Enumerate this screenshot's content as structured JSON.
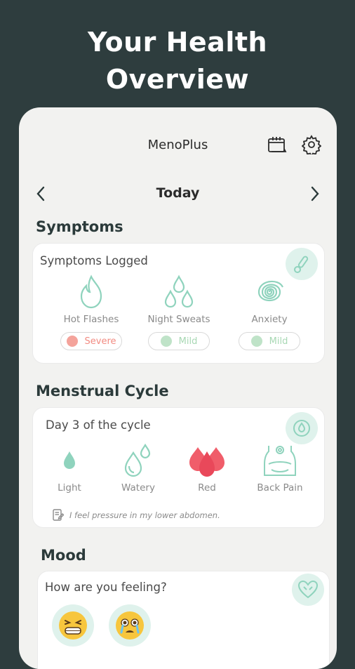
{
  "hero": {
    "line1": "Your Health",
    "line2": "Overview"
  },
  "header": {
    "title": "MenoPlus",
    "icons": [
      "calendar-icon",
      "gear-icon"
    ]
  },
  "date_nav": {
    "label": "Today",
    "prev_icon": "chevron-left-icon",
    "next_icon": "chevron-right-icon"
  },
  "symptoms": {
    "section_title": "Symptoms",
    "card_title": "Symptoms Logged",
    "badge_icon": "thermometer-icon",
    "items": [
      {
        "label": "Hot Flashes",
        "icon": "flame-icon",
        "severity": "Severe",
        "severity_color": "#f4a39b"
      },
      {
        "label": "Night Sweats",
        "icon": "drops-icon",
        "severity": "Mild",
        "severity_color": "#bfe3c8"
      },
      {
        "label": "Anxiety",
        "icon": "spiral-icon",
        "severity": "Mild",
        "severity_color": "#bfe3c8"
      }
    ]
  },
  "cycle": {
    "section_title": "Menstrual Cycle",
    "card_title": "Day 3 of the cycle",
    "badge_icon": "cycle-icon",
    "items": [
      {
        "label": "Light",
        "icon": "single-drop-icon"
      },
      {
        "label": "Watery",
        "icon": "watery-drops-icon"
      },
      {
        "label": "Red",
        "icon": "red-drops-icon"
      },
      {
        "label": "Back Pain",
        "icon": "back-pain-icon"
      }
    ],
    "note": "I feel pressure in my lower abdomen."
  },
  "mood": {
    "section_title": "Mood",
    "card_title": "How are you feeling?",
    "badge_icon": "heart-icon",
    "emojis": [
      "grimacing-face-icon",
      "crying-face-icon"
    ]
  },
  "colors": {
    "background": "#2e3d3e",
    "accent": "#8fd3bd",
    "accent_light": "#dff2ec",
    "red": "#f05d6a"
  }
}
